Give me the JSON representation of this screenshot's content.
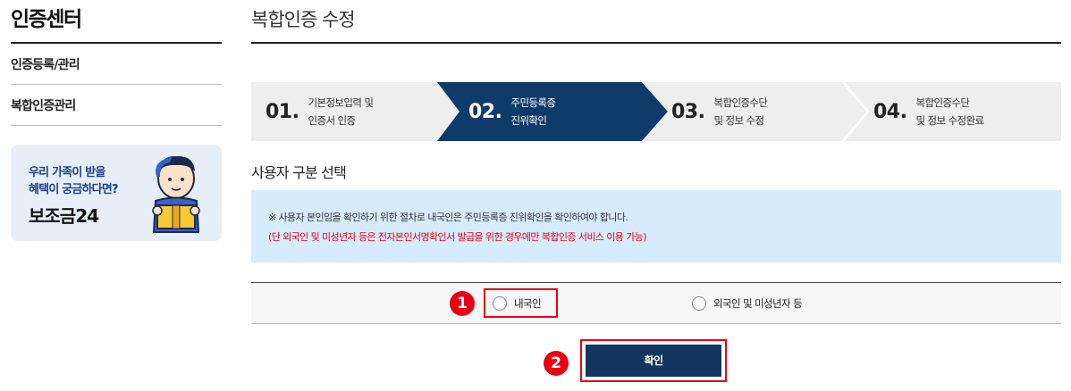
{
  "sidebar": {
    "title": "인증센터",
    "items": [
      {
        "label": "인증등록/관리"
      },
      {
        "label": "복합인증관리"
      }
    ],
    "banner": {
      "line1": "우리 가족이 받을",
      "line2": "혜택이 궁금하다면?",
      "brand": "보조금24"
    }
  },
  "main": {
    "title": "복합인증 수정",
    "steps": [
      {
        "num": "01.",
        "line1": "기본정보입력 및",
        "line2": "인증서 인증",
        "active": false
      },
      {
        "num": "02.",
        "line1": "주민등록증",
        "line2": "진위확인",
        "active": true
      },
      {
        "num": "03.",
        "line1": "복합인증수단",
        "line2": "및 정보 수정",
        "active": false
      },
      {
        "num": "04.",
        "line1": "복합인증수단",
        "line2": "및 정보 수정완료",
        "active": false
      }
    ],
    "section_title": "사용자 구분 선택",
    "notice": {
      "line1": "※ 사용자 본인임을 확인하기 위한 절차로 내국인은 주민등록증 진위확인을 확인하여야 합니다.",
      "line2": "(단 외국인 및 미성년자 등은 전자본인서명확인서 발급을 위한 경우에만 복합인증 서비스 이용 가능)"
    },
    "radio_options": [
      {
        "label": "내국인",
        "selected": false
      },
      {
        "label": "외국인 및 미성년자 등",
        "selected": false
      }
    ],
    "markers": [
      "1",
      "2"
    ],
    "confirm_label": "확인"
  },
  "colors": {
    "active_step": "#0f3b6b",
    "inactive_step": "#eeeeee",
    "notice_bg": "#d6ecfd",
    "highlight": "#e60012",
    "confirm_button": "#12365e"
  }
}
